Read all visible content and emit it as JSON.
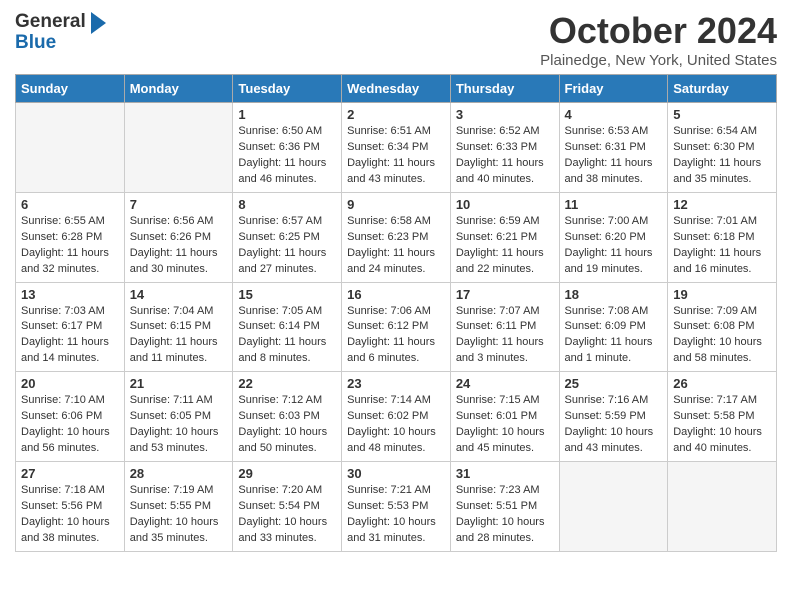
{
  "header": {
    "logo_line1": "General",
    "logo_line2": "Blue",
    "month": "October 2024",
    "location": "Plainedge, New York, United States"
  },
  "days_of_week": [
    "Sunday",
    "Monday",
    "Tuesday",
    "Wednesday",
    "Thursday",
    "Friday",
    "Saturday"
  ],
  "weeks": [
    [
      {
        "day": "",
        "empty": true
      },
      {
        "day": "",
        "empty": true
      },
      {
        "day": "1",
        "rise": "Sunrise: 6:50 AM",
        "set": "Sunset: 6:36 PM",
        "daylight": "Daylight: 11 hours and 46 minutes."
      },
      {
        "day": "2",
        "rise": "Sunrise: 6:51 AM",
        "set": "Sunset: 6:34 PM",
        "daylight": "Daylight: 11 hours and 43 minutes."
      },
      {
        "day": "3",
        "rise": "Sunrise: 6:52 AM",
        "set": "Sunset: 6:33 PM",
        "daylight": "Daylight: 11 hours and 40 minutes."
      },
      {
        "day": "4",
        "rise": "Sunrise: 6:53 AM",
        "set": "Sunset: 6:31 PM",
        "daylight": "Daylight: 11 hours and 38 minutes."
      },
      {
        "day": "5",
        "rise": "Sunrise: 6:54 AM",
        "set": "Sunset: 6:30 PM",
        "daylight": "Daylight: 11 hours and 35 minutes."
      }
    ],
    [
      {
        "day": "6",
        "rise": "Sunrise: 6:55 AM",
        "set": "Sunset: 6:28 PM",
        "daylight": "Daylight: 11 hours and 32 minutes."
      },
      {
        "day": "7",
        "rise": "Sunrise: 6:56 AM",
        "set": "Sunset: 6:26 PM",
        "daylight": "Daylight: 11 hours and 30 minutes."
      },
      {
        "day": "8",
        "rise": "Sunrise: 6:57 AM",
        "set": "Sunset: 6:25 PM",
        "daylight": "Daylight: 11 hours and 27 minutes."
      },
      {
        "day": "9",
        "rise": "Sunrise: 6:58 AM",
        "set": "Sunset: 6:23 PM",
        "daylight": "Daylight: 11 hours and 24 minutes."
      },
      {
        "day": "10",
        "rise": "Sunrise: 6:59 AM",
        "set": "Sunset: 6:21 PM",
        "daylight": "Daylight: 11 hours and 22 minutes."
      },
      {
        "day": "11",
        "rise": "Sunrise: 7:00 AM",
        "set": "Sunset: 6:20 PM",
        "daylight": "Daylight: 11 hours and 19 minutes."
      },
      {
        "day": "12",
        "rise": "Sunrise: 7:01 AM",
        "set": "Sunset: 6:18 PM",
        "daylight": "Daylight: 11 hours and 16 minutes."
      }
    ],
    [
      {
        "day": "13",
        "rise": "Sunrise: 7:03 AM",
        "set": "Sunset: 6:17 PM",
        "daylight": "Daylight: 11 hours and 14 minutes."
      },
      {
        "day": "14",
        "rise": "Sunrise: 7:04 AM",
        "set": "Sunset: 6:15 PM",
        "daylight": "Daylight: 11 hours and 11 minutes."
      },
      {
        "day": "15",
        "rise": "Sunrise: 7:05 AM",
        "set": "Sunset: 6:14 PM",
        "daylight": "Daylight: 11 hours and 8 minutes."
      },
      {
        "day": "16",
        "rise": "Sunrise: 7:06 AM",
        "set": "Sunset: 6:12 PM",
        "daylight": "Daylight: 11 hours and 6 minutes."
      },
      {
        "day": "17",
        "rise": "Sunrise: 7:07 AM",
        "set": "Sunset: 6:11 PM",
        "daylight": "Daylight: 11 hours and 3 minutes."
      },
      {
        "day": "18",
        "rise": "Sunrise: 7:08 AM",
        "set": "Sunset: 6:09 PM",
        "daylight": "Daylight: 11 hours and 1 minute."
      },
      {
        "day": "19",
        "rise": "Sunrise: 7:09 AM",
        "set": "Sunset: 6:08 PM",
        "daylight": "Daylight: 10 hours and 58 minutes."
      }
    ],
    [
      {
        "day": "20",
        "rise": "Sunrise: 7:10 AM",
        "set": "Sunset: 6:06 PM",
        "daylight": "Daylight: 10 hours and 56 minutes."
      },
      {
        "day": "21",
        "rise": "Sunrise: 7:11 AM",
        "set": "Sunset: 6:05 PM",
        "daylight": "Daylight: 10 hours and 53 minutes."
      },
      {
        "day": "22",
        "rise": "Sunrise: 7:12 AM",
        "set": "Sunset: 6:03 PM",
        "daylight": "Daylight: 10 hours and 50 minutes."
      },
      {
        "day": "23",
        "rise": "Sunrise: 7:14 AM",
        "set": "Sunset: 6:02 PM",
        "daylight": "Daylight: 10 hours and 48 minutes."
      },
      {
        "day": "24",
        "rise": "Sunrise: 7:15 AM",
        "set": "Sunset: 6:01 PM",
        "daylight": "Daylight: 10 hours and 45 minutes."
      },
      {
        "day": "25",
        "rise": "Sunrise: 7:16 AM",
        "set": "Sunset: 5:59 PM",
        "daylight": "Daylight: 10 hours and 43 minutes."
      },
      {
        "day": "26",
        "rise": "Sunrise: 7:17 AM",
        "set": "Sunset: 5:58 PM",
        "daylight": "Daylight: 10 hours and 40 minutes."
      }
    ],
    [
      {
        "day": "27",
        "rise": "Sunrise: 7:18 AM",
        "set": "Sunset: 5:56 PM",
        "daylight": "Daylight: 10 hours and 38 minutes."
      },
      {
        "day": "28",
        "rise": "Sunrise: 7:19 AM",
        "set": "Sunset: 5:55 PM",
        "daylight": "Daylight: 10 hours and 35 minutes."
      },
      {
        "day": "29",
        "rise": "Sunrise: 7:20 AM",
        "set": "Sunset: 5:54 PM",
        "daylight": "Daylight: 10 hours and 33 minutes."
      },
      {
        "day": "30",
        "rise": "Sunrise: 7:21 AM",
        "set": "Sunset: 5:53 PM",
        "daylight": "Daylight: 10 hours and 31 minutes."
      },
      {
        "day": "31",
        "rise": "Sunrise: 7:23 AM",
        "set": "Sunset: 5:51 PM",
        "daylight": "Daylight: 10 hours and 28 minutes."
      },
      {
        "day": "",
        "empty": true
      },
      {
        "day": "",
        "empty": true
      }
    ]
  ]
}
